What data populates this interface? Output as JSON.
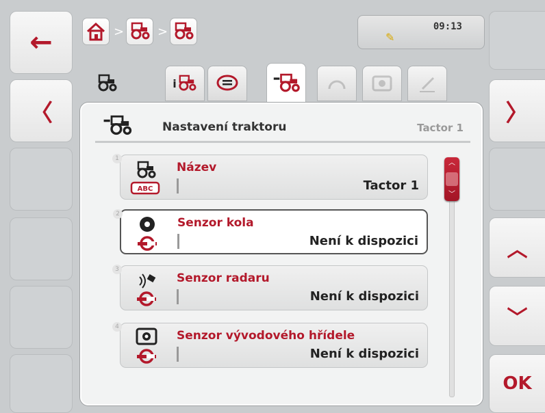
{
  "nav": {
    "back_arrow": "←",
    "prev_chevron": "〈",
    "next_chevron": "〉",
    "scroll_up": "︿",
    "scroll_down": "﹀",
    "ok_label": "OK"
  },
  "header": {
    "breadcrumb_sep": ">",
    "time": "09:13",
    "icons": [
      "home-icon",
      "tractor-icon",
      "tractor-settings-icon"
    ]
  },
  "tabs": [
    {
      "name": "tractor",
      "state": "normal"
    },
    {
      "name": "tractor-info",
      "state": "normal"
    },
    {
      "name": "comments",
      "state": "normal"
    },
    {
      "name": "tractor-settings",
      "state": "active"
    },
    {
      "name": "gauge",
      "state": "disabled"
    },
    {
      "name": "pto",
      "state": "disabled"
    },
    {
      "name": "edit",
      "state": "disabled"
    }
  ],
  "panel": {
    "title": "Nastavení traktoru",
    "subtitle": "Tactor 1"
  },
  "rows": [
    {
      "num": "1",
      "label": "Název",
      "value": "Tactor 1"
    },
    {
      "num": "2",
      "label": "Senzor kola",
      "value": "Není k dispozici"
    },
    {
      "num": "3",
      "label": "Senzor radaru",
      "value": "Není k dispozici"
    },
    {
      "num": "4",
      "label": "Senzor vývodového hřídele",
      "value": "Není k dispozici"
    }
  ],
  "colors": {
    "accent": "#b3192b",
    "panel_bg": "#f2f3f3",
    "background": "#c9ccce"
  }
}
